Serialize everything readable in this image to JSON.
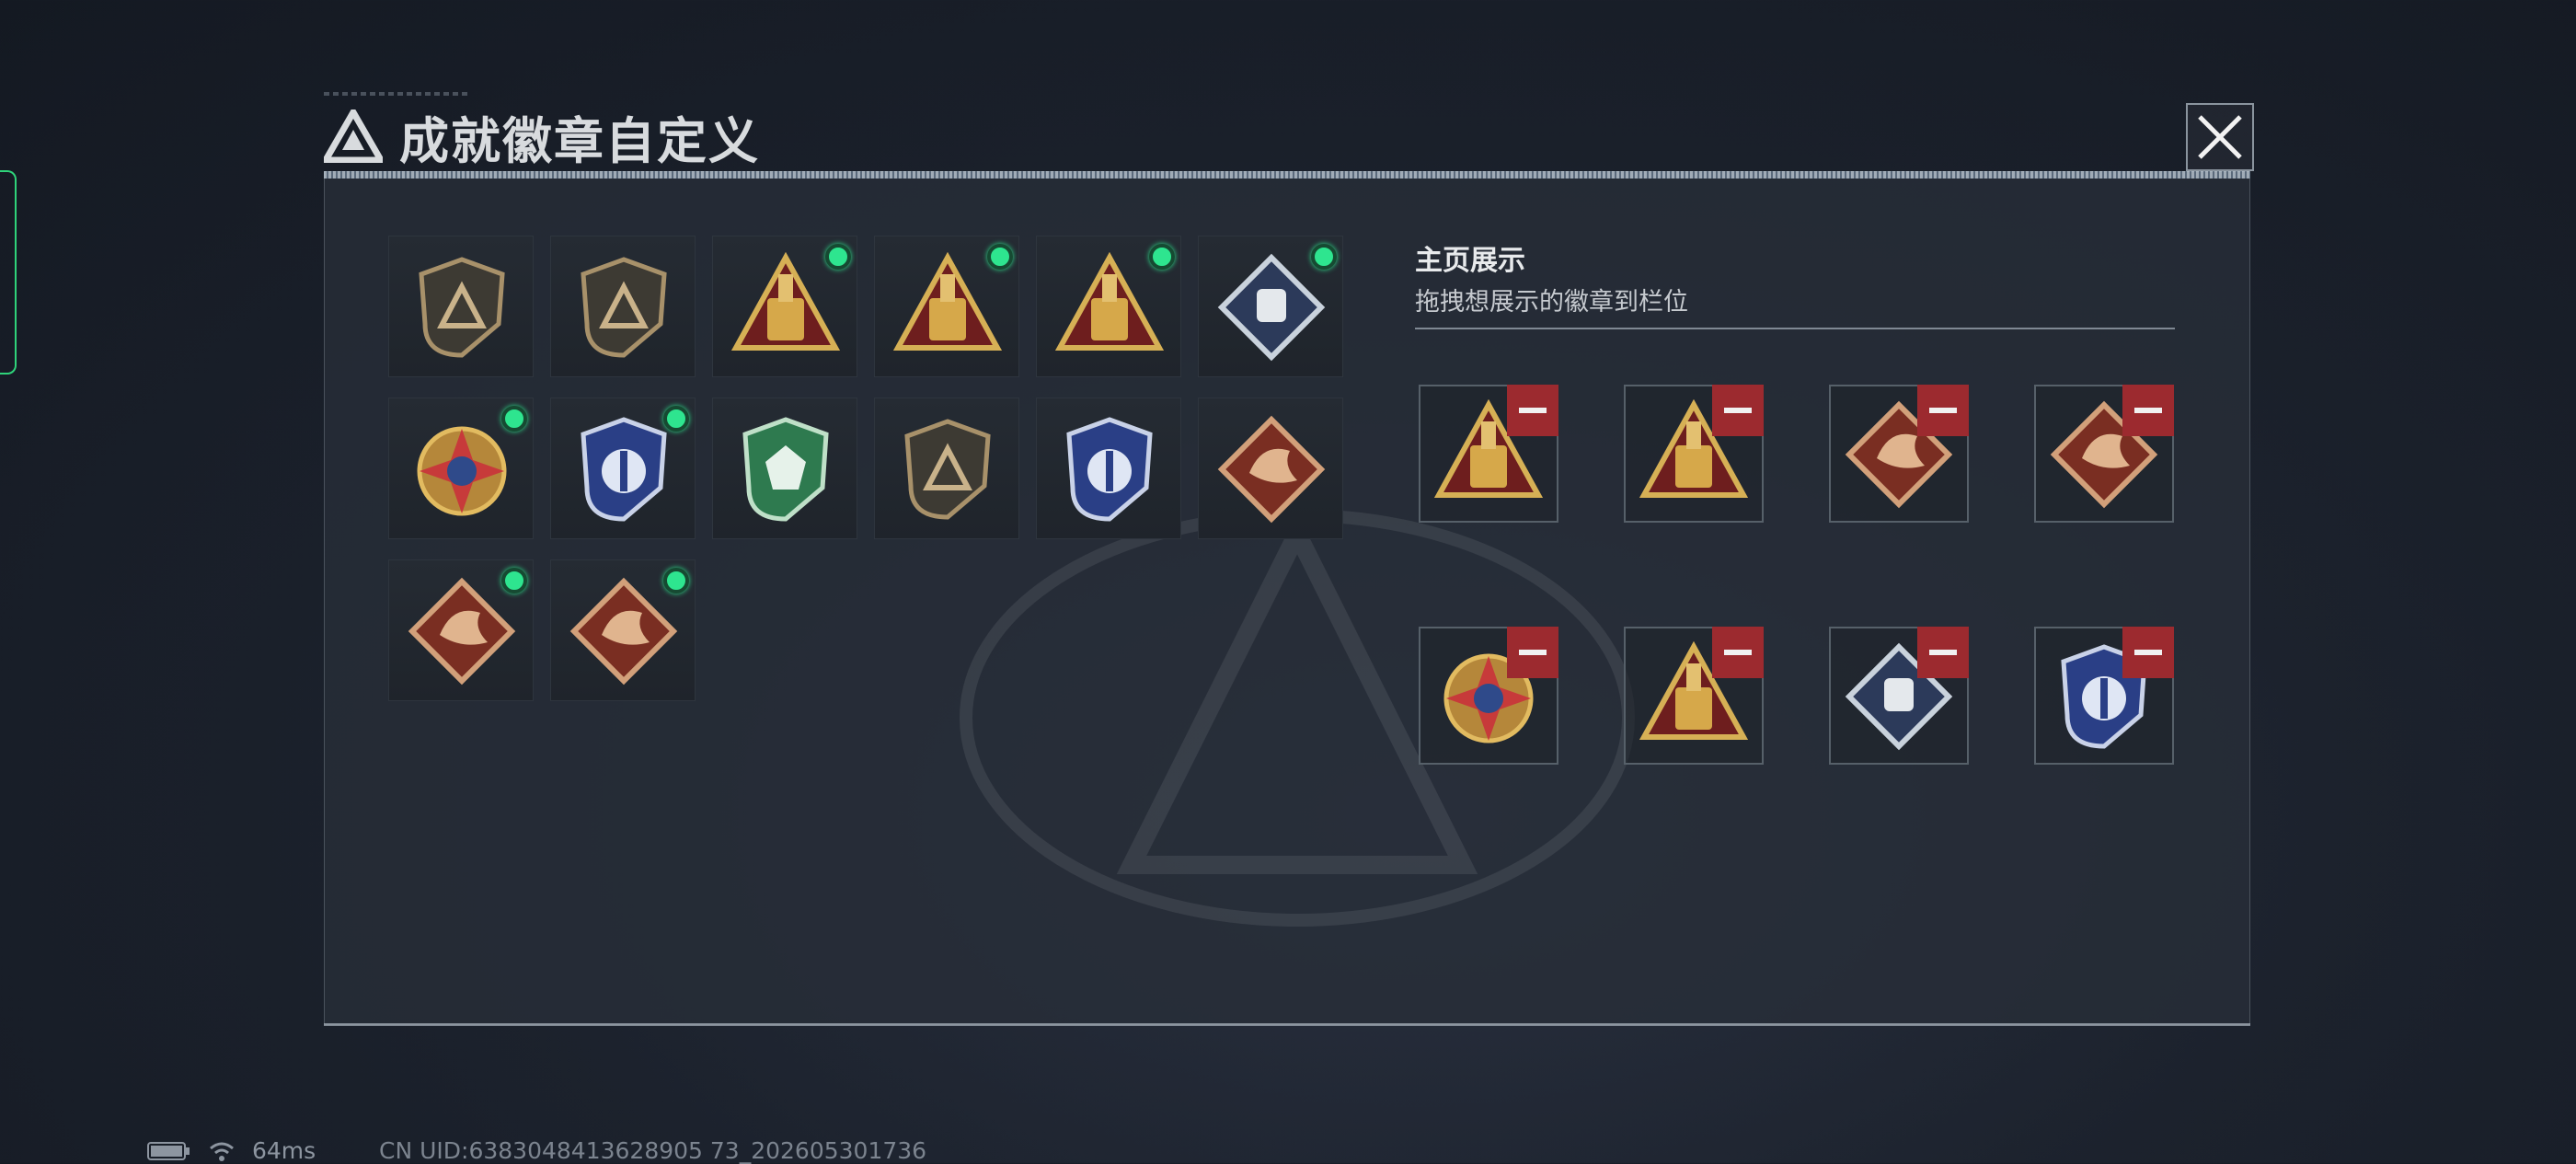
{
  "header": {
    "title": "成就徽章自定义",
    "logo_icon": "triangle-a-logo-icon",
    "close_icon": "close-x-icon"
  },
  "inventory": {
    "badges": [
      {
        "name": "shield-triangle-badge",
        "equipped": false,
        "palette": "bronze-shield"
      },
      {
        "name": "helicopter-badge",
        "equipped": false,
        "palette": "bronze-shield"
      },
      {
        "name": "golden-59-badge",
        "equipped": true,
        "palette": "gold-triangle"
      },
      {
        "name": "golden-soldiers-badge",
        "equipped": true,
        "palette": "gold-triangle"
      },
      {
        "name": "golden-rocket-badge",
        "equipped": true,
        "palette": "gold-triangle"
      },
      {
        "name": "silver-fist-badge",
        "equipped": true,
        "palette": "silver-diamond"
      },
      {
        "name": "star-compass-badge",
        "equipped": true,
        "palette": "gold-round"
      },
      {
        "name": "blue-emblem-badge",
        "equipped": true,
        "palette": "blue-shield"
      },
      {
        "name": "green-gem-badge",
        "equipped": false,
        "palette": "green-shield"
      },
      {
        "name": "rifle-shield-badge",
        "equipped": false,
        "palette": "bronze-shield"
      },
      {
        "name": "blue-sword-badge",
        "equipped": false,
        "palette": "blue-shield"
      },
      {
        "name": "dragon-badge",
        "equipped": false,
        "palette": "red-diamond"
      },
      {
        "name": "dragon-badge-2",
        "equipped": true,
        "palette": "red-diamond"
      },
      {
        "name": "runner-badge",
        "equipped": true,
        "palette": "red-diamond"
      }
    ]
  },
  "showcase": {
    "title": "主页展示",
    "subtitle": "拖拽想展示的徽章到栏位",
    "slots": [
      {
        "name": "golden-rocket-badge",
        "palette": "gold-triangle"
      },
      {
        "name": "golden-soldiers-badge",
        "palette": "gold-triangle"
      },
      {
        "name": "dragon-badge",
        "palette": "red-diamond"
      },
      {
        "name": "runner-badge",
        "palette": "red-diamond"
      },
      {
        "name": "star-compass-badge",
        "palette": "gold-round"
      },
      {
        "name": "golden-59-badge",
        "palette": "gold-triangle"
      },
      {
        "name": "silver-fist-badge",
        "palette": "silver-diamond"
      },
      {
        "name": "blue-emblem-badge",
        "palette": "blue-shield"
      }
    ],
    "remove_icon": "minus-icon"
  },
  "status_bar": {
    "latency": "64ms",
    "uid": "CN UID:6383048413628905 73_202605301736",
    "battery_icon": "battery-icon",
    "wifi_icon": "wifi-icon"
  },
  "colors": {
    "equipped_dot": "#2ee58f",
    "remove_red": "#9c2a2f",
    "gold": "#c9a24a"
  }
}
